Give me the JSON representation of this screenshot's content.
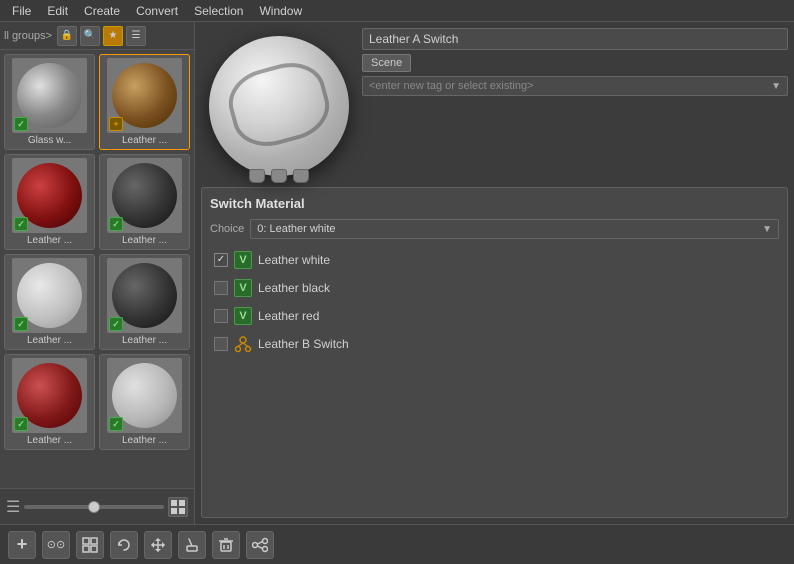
{
  "menubar": {
    "items": [
      "File",
      "Edit",
      "Create",
      "Convert",
      "Selection",
      "Window"
    ]
  },
  "leftpanel": {
    "toolbar": {
      "groups_label": "ll groups>",
      "buttons": [
        "lock",
        "search",
        "filter",
        "list"
      ]
    },
    "materials": [
      {
        "label": "Glass w...",
        "sphere": "glass",
        "badge": "green",
        "active": false
      },
      {
        "label": "Leather ...",
        "sphere": "leather-orange",
        "badge": "orange",
        "active": true
      },
      {
        "label": "Leather ...",
        "sphere": "leather-red",
        "badge": "green",
        "active": false
      },
      {
        "label": "Leather ...",
        "sphere": "leather-black",
        "badge": "green",
        "active": false
      },
      {
        "label": "Leather ...",
        "sphere": "leather-white",
        "badge": "green",
        "active": false
      },
      {
        "label": "Leather ...",
        "sphere": "leather-black2",
        "badge": "green",
        "active": false
      },
      {
        "label": "Leather ...",
        "sphere": "leather-red2",
        "badge": "green",
        "active": false
      },
      {
        "label": "Leather ...",
        "sphere": "leather-white2",
        "badge": "green",
        "active": false
      }
    ]
  },
  "rightpanel": {
    "material_name": "Leather A Switch",
    "scene_tag": "Scene",
    "tag_placeholder": "<enter new tag or select existing>",
    "switch_material": {
      "title": "Switch Material",
      "choice_label": "Choice",
      "choice_value": "0: Leather white",
      "materials": [
        {
          "name": "Leather white",
          "icon": "v",
          "checked": true
        },
        {
          "name": "Leather black",
          "icon": "v",
          "checked": false
        },
        {
          "name": "Leather red",
          "icon": "v",
          "checked": false
        },
        {
          "name": "Leather B Switch",
          "icon": "switch",
          "checked": false
        }
      ]
    }
  },
  "bottomtoolbar": {
    "buttons": [
      "+",
      "⊙⊙",
      "⊞",
      "↺",
      "⌂",
      "⌦",
      "✂",
      "⟳"
    ]
  }
}
